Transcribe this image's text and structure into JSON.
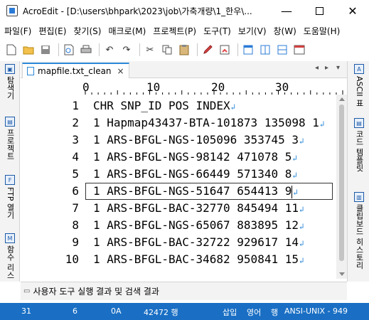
{
  "window": {
    "title": "AcroEdit - [D:\\users\\bhpark\\2023\\job\\가축개량\\1_한우\\..."
  },
  "menu": [
    "파일(F)",
    "편집(E)",
    "찾기(S)",
    "매크로(M)",
    "프로젝트(P)",
    "도구(T)",
    "보기(V)",
    "창(W)",
    "도움말(H)"
  ],
  "toolbar": {
    "icons": [
      "new-file-icon",
      "open-folder-icon",
      "save-icon",
      "print-preview-icon",
      "print-icon",
      "undo-icon",
      "redo-icon",
      "cut-icon",
      "copy-icon",
      "paste-icon",
      "marker-icon",
      "bookmark-icon",
      "window-icon",
      "multi-window-icon",
      "tile-icon",
      "calendar-icon"
    ]
  },
  "left_panel": {
    "tabs": [
      "탐색기",
      "프로젝트",
      "FTP 열기",
      "함수 리스"
    ]
  },
  "right_panel": {
    "tabs": [
      "ASCII 표",
      "코드 템플릿",
      "클립보드 히스토리"
    ]
  },
  "tab": {
    "label": "mapfile.txt_clean",
    "close": "×"
  },
  "ruler": {
    "labels": [
      "0",
      "10",
      "20",
      "30"
    ]
  },
  "editor": {
    "eol_symbol": "↲",
    "current_line": 6,
    "lines": [
      {
        "num": "1",
        "text": "CHR SNP_ID POS INDEX"
      },
      {
        "num": "2",
        "text": "1 Hapmap43437-BTA-101873 135098 1"
      },
      {
        "num": "3",
        "text": "1 ARS-BFGL-NGS-105096 353745 3"
      },
      {
        "num": "4",
        "text": "1 ARS-BFGL-NGS-98142 471078 5"
      },
      {
        "num": "5",
        "text": "1 ARS-BFGL-NGS-66449 571340 8"
      },
      {
        "num": "6",
        "text": "1 ARS-BFGL-NGS-51647 654413 9"
      },
      {
        "num": "7",
        "text": "1 ARS-BFGL-BAC-32770 845494 11"
      },
      {
        "num": "8",
        "text": "1 ARS-BFGL-NGS-65067 883895 12"
      },
      {
        "num": "9",
        "text": "1 ARS-BFGL-BAC-32722 929617 14"
      },
      {
        "num": "10",
        "text": "1 ARS-BFGL-BAC-34682 950841 15"
      }
    ]
  },
  "output_panel": {
    "label": "사용자 도구 실행 결과 및 검색 결과"
  },
  "status": {
    "col": "31",
    "ch": "6",
    "hex": "0A",
    "lines": "42472 행",
    "insert": "삽입",
    "lang": "영어",
    "row": "행",
    "encoding": "ANSI-UNIX - 949"
  },
  "colors": {
    "statusbar": "#1a6fc4",
    "tab_accent": "#2b88d8",
    "eol": "#2b88d8"
  }
}
